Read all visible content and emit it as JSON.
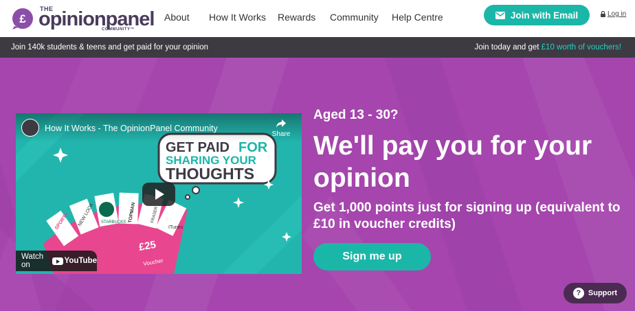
{
  "header": {
    "logo": {
      "the": "THE",
      "name": "opinionpanel",
      "community": "COMMUNITY™",
      "badge_symbol": "£"
    },
    "nav": [
      {
        "label": "About"
      },
      {
        "label": "How It Works"
      },
      {
        "label": "Rewards"
      },
      {
        "label": "Community"
      },
      {
        "label": "Help Centre"
      }
    ],
    "join_button": "Join with Email",
    "login": "Log in"
  },
  "promo": {
    "left": "Join 140k students & teens and get paid for your opinion",
    "right_prefix": "Join today and get ",
    "right_accent": "£10 worth of vouchers!"
  },
  "video": {
    "title": "How It Works - The OpinionPanel Community",
    "share": "Share",
    "watch_on": "Watch on",
    "youtube": "YouTube",
    "thumbnail": {
      "line1a": "GET PAID",
      "line1b": "FOR",
      "line2": "SHARING YOUR",
      "line3": "THOUGHTS",
      "voucher_value": "£25",
      "voucher_word": "Voucher",
      "brands": [
        "SPORTS",
        "NEW LOOK",
        "STARBUCKS",
        "TOPMAN",
        "FRASER",
        "ITunes"
      ]
    }
  },
  "hero": {
    "age": "Aged 13 - 30?",
    "headline": "We'll pay you for your opinion",
    "subhead": "Get 1,000 points just for signing up (equivalent to £10 in voucher credits)",
    "cta": "Sign me up"
  },
  "support": {
    "label": "Support"
  },
  "colors": {
    "teal": "#1ab7a8",
    "purple": "#a545ad",
    "dark_bar": "#3d3a42",
    "promo_accent": "#1ed3c3",
    "pink": "#e8468f"
  }
}
